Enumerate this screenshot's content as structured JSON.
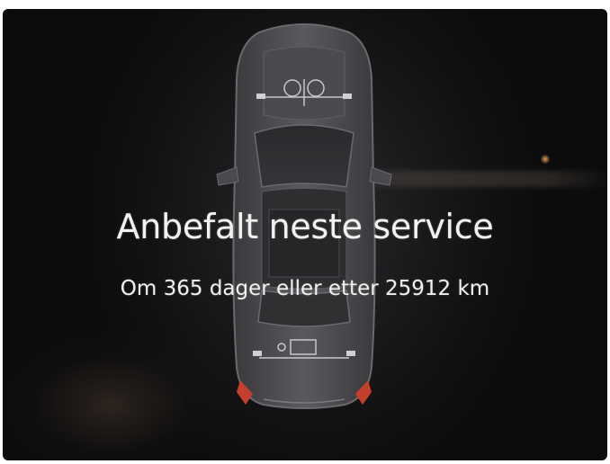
{
  "display": {
    "title": "Anbefalt neste service",
    "subtitle": "Om 365 dager eller etter 25912 km",
    "vehicle_graphic": "car-top-view-icon",
    "colors": {
      "background": "#141415",
      "text": "#f2f2f2",
      "tail_light": "#c4402c"
    }
  }
}
